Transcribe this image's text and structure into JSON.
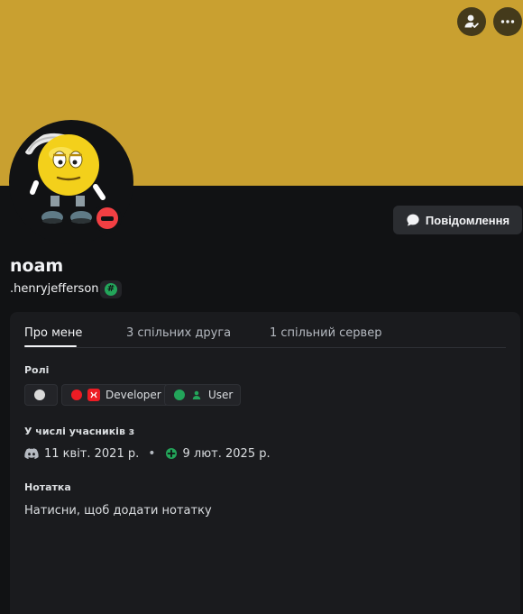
{
  "colors": {
    "banner": "#c9a030",
    "background": "#111214",
    "card": "#1a1b1e",
    "dnd_status": "#f23f43",
    "role_developer": "#ed1c24",
    "role_user": "#23a55a",
    "role_blank": "#d9d9d9"
  },
  "banner": {
    "friend_icon": "user-check-icon",
    "more_icon": "ellipsis-icon"
  },
  "avatar": {
    "description_icon": "saluting-smiley-avatar",
    "status": "do-not-disturb"
  },
  "actions": {
    "message_label": "Повідомлення",
    "message_icon": "chat-bubble-icon"
  },
  "profile": {
    "display_name": "noam",
    "username": ".henryjefferson",
    "badge_icon": "hashtag-badge-icon"
  },
  "tabs": [
    {
      "label": "Про мене",
      "active": true
    },
    {
      "label": "3 спільних друга",
      "active": false
    },
    {
      "label": "1 спільний сервер",
      "active": false
    }
  ],
  "roles": {
    "title": "Ролі",
    "items": [
      {
        "label": "",
        "color": "#d9d9d9"
      },
      {
        "label": "Developer",
        "color": "#ed1c24",
        "icon": "developer-role-icon"
      },
      {
        "label": "User",
        "color": "#23a55a",
        "icon": "user-role-icon"
      }
    ]
  },
  "member_since": {
    "title": "У числі учасників з",
    "discord_date": "11 квіт. 2021 р.",
    "discord_icon": "discord-logo-icon",
    "server_date": "9 лют. 2025 р.",
    "server_icon": "server-icon"
  },
  "note": {
    "title": "Нотатка",
    "placeholder": "Натисни, щоб додати нотатку"
  }
}
